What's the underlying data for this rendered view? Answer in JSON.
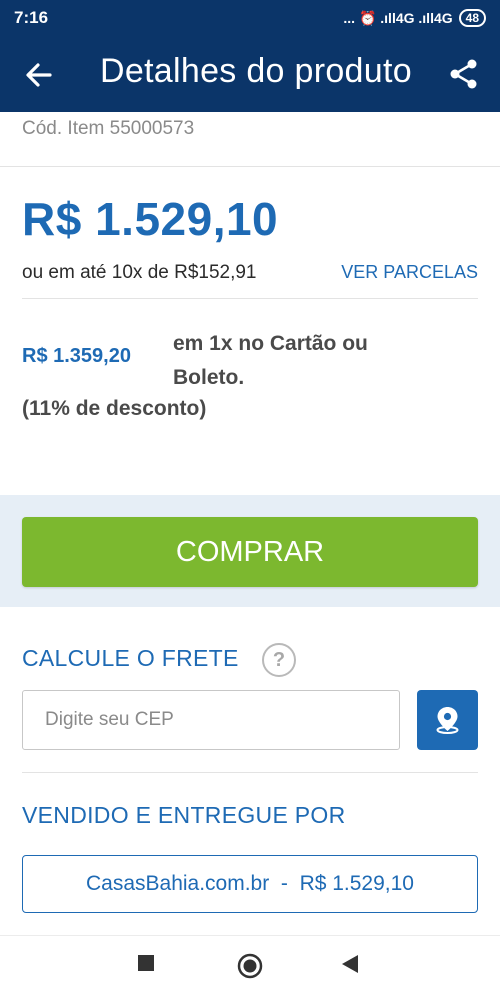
{
  "status_bar": {
    "time": "7:16",
    "icons": "... ⏰ .ıll4G .ıll4G",
    "battery": "48"
  },
  "app_bar": {
    "title": "Detalhes do produto",
    "back_icon": "arrow-left-icon",
    "share_icon": "share-icon"
  },
  "product": {
    "item_code": "Cód. Item 55000573",
    "price": "R$ 1.529,10",
    "installments": "ou em até 10x de R$152,91",
    "installments_link": "VER PARCELAS",
    "discount_price": "R$ 1.359,20",
    "discount_text": "em 1x no Cartão ou Boleto.",
    "discount_percent": "(11% de desconto)"
  },
  "buy": {
    "label": "COMPRAR",
    "color": "#7cb82f"
  },
  "shipping": {
    "title": "CALCULE O FRETE",
    "help": "?",
    "cep_placeholder": "Digite seu CEP",
    "location_icon": "map-pin-icon"
  },
  "seller": {
    "title": "VENDIDO E ENTREGUE POR",
    "offer": "CasasBahia.com.br  -  R$ 1.529,10"
  },
  "colors": {
    "header": "#0b3569",
    "accent": "#1e6ab4",
    "buy_button": "#7cb82f"
  }
}
